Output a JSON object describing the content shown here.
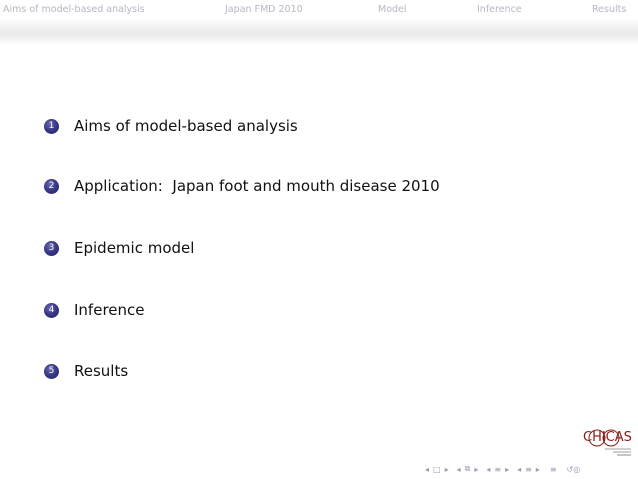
{
  "header": {
    "nav": [
      {
        "label": "Aims of model-based analysis"
      },
      {
        "label": "Japan FMD 2010"
      },
      {
        "label": "Model"
      },
      {
        "label": "Inference"
      },
      {
        "label": "Results"
      }
    ]
  },
  "toc": {
    "items": [
      {
        "number": "1",
        "label": "Aims of model-based analysis"
      },
      {
        "number": "2",
        "label": "Application:  Japan foot and mouth disease 2010"
      },
      {
        "number": "3",
        "label": "Epidemic model"
      },
      {
        "number": "4",
        "label": "Inference"
      },
      {
        "number": "5",
        "label": "Results"
      }
    ]
  },
  "logo": {
    "text": "CHICAS"
  },
  "colors": {
    "accent": "#2e2e78",
    "nav_text": "#b7b7c4",
    "logo": "#8b1a1a"
  },
  "footer_icons": [
    "frame-prev-icon",
    "frame-next-icon",
    "subsection-prev-icon",
    "subsection-next-icon",
    "section-prev-icon",
    "section-next-icon",
    "align-icon",
    "search-icon"
  ]
}
